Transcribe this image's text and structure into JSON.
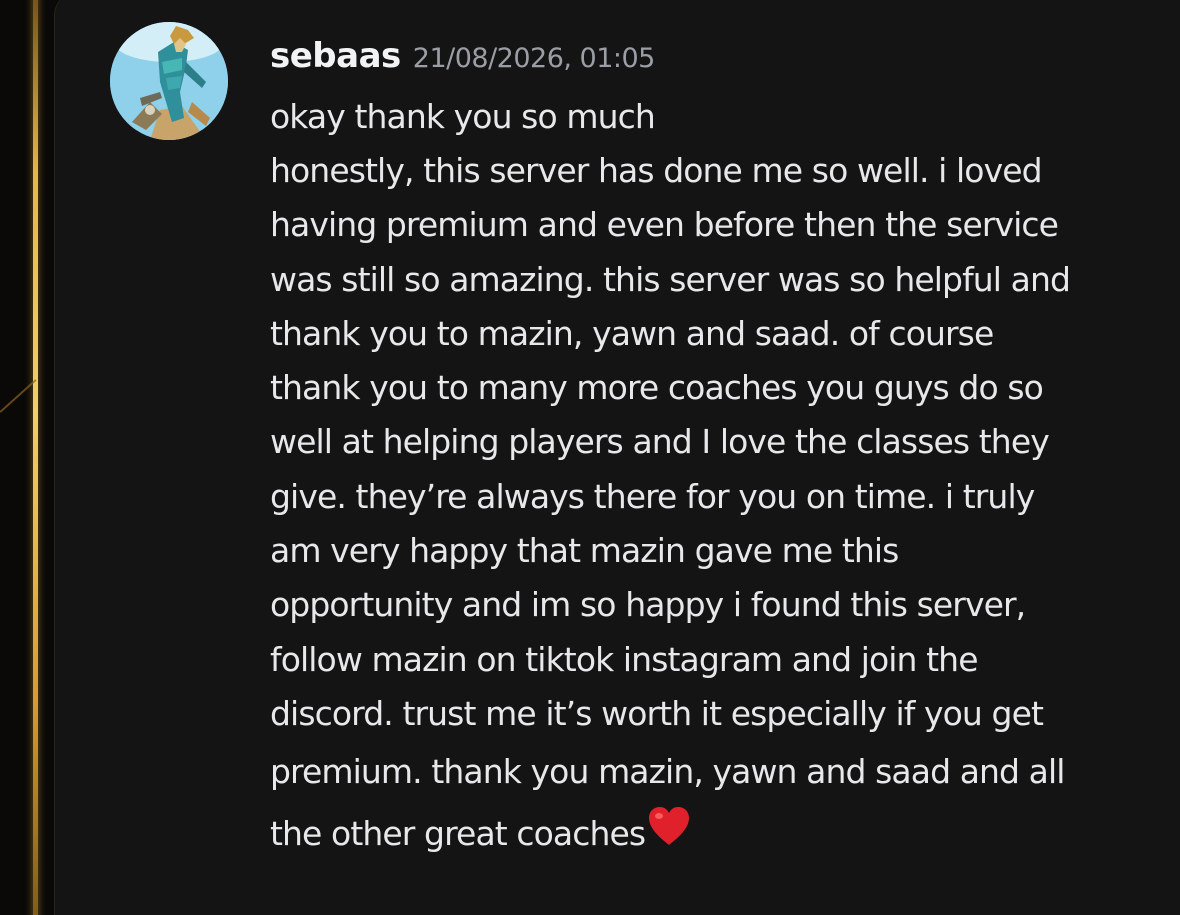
{
  "message": {
    "username": "sebaas",
    "timestamp": "21/08/2026, 01:05",
    "avatar_icon": "avatar-image",
    "heart_icon": "red-heart-emoji",
    "lines": [
      "okay thank you so much",
      "honestly, this server has done me so well. i loved",
      "having premium and even before then the service",
      "was still so amazing. this server was so helpful and",
      "thank you to mazin, yawn and saad. of course",
      "thank you to many more coaches you guys do so",
      "well at helping players and I love the classes they",
      "give. they’re always there for you on time. i truly",
      "am very happy that mazin gave me this",
      "opportunity and im so happy i found this server,",
      "follow mazin on tiktok instagram and join the",
      "discord. trust me it’s worth it especially if you get",
      "premium. thank you mazin, yawn and saad and all",
      "the other great coaches"
    ]
  },
  "colors": {
    "background": "#141414",
    "frame_accent": "#e7b54a",
    "username": "#f2f3f5",
    "timestamp": "#9b9ea5",
    "text": "#e8e8ea",
    "heart": "#e0202a"
  }
}
